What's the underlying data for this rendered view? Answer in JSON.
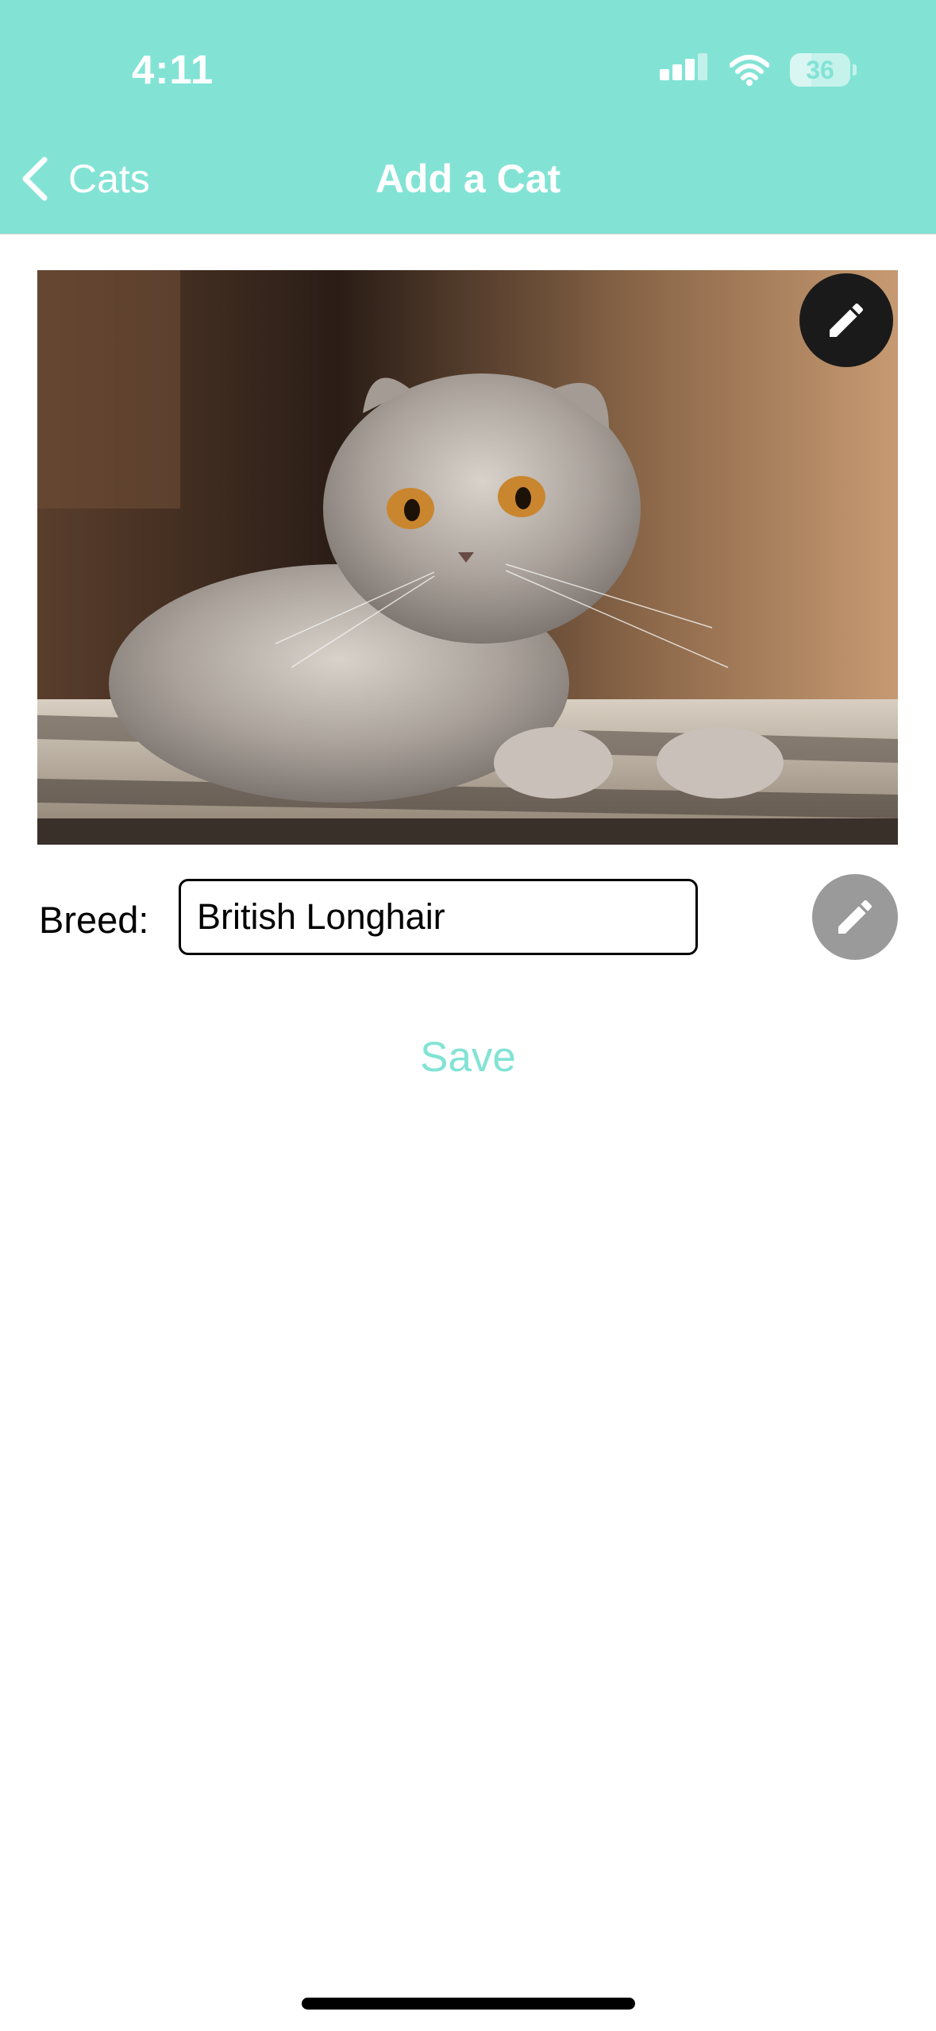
{
  "status_bar": {
    "time": "4:11",
    "battery_level": "36",
    "battery_fraction": 0.36,
    "icons": [
      "signal-icon",
      "wifi-icon",
      "battery-icon"
    ]
  },
  "nav": {
    "back_label": "Cats",
    "title": "Add a Cat"
  },
  "photo": {
    "subject": "cat-photo",
    "edit_icon": "pencil-icon"
  },
  "breed": {
    "label": "Breed:",
    "value": "British Longhair",
    "edit_icon": "pencil-icon"
  },
  "actions": {
    "save_label": "Save"
  },
  "colors": {
    "accent": "#82e3d5",
    "header_text": "#ffffff",
    "edit_button_dark": "#1a1a1a",
    "edit_button_grey": "#9a9a9a"
  }
}
